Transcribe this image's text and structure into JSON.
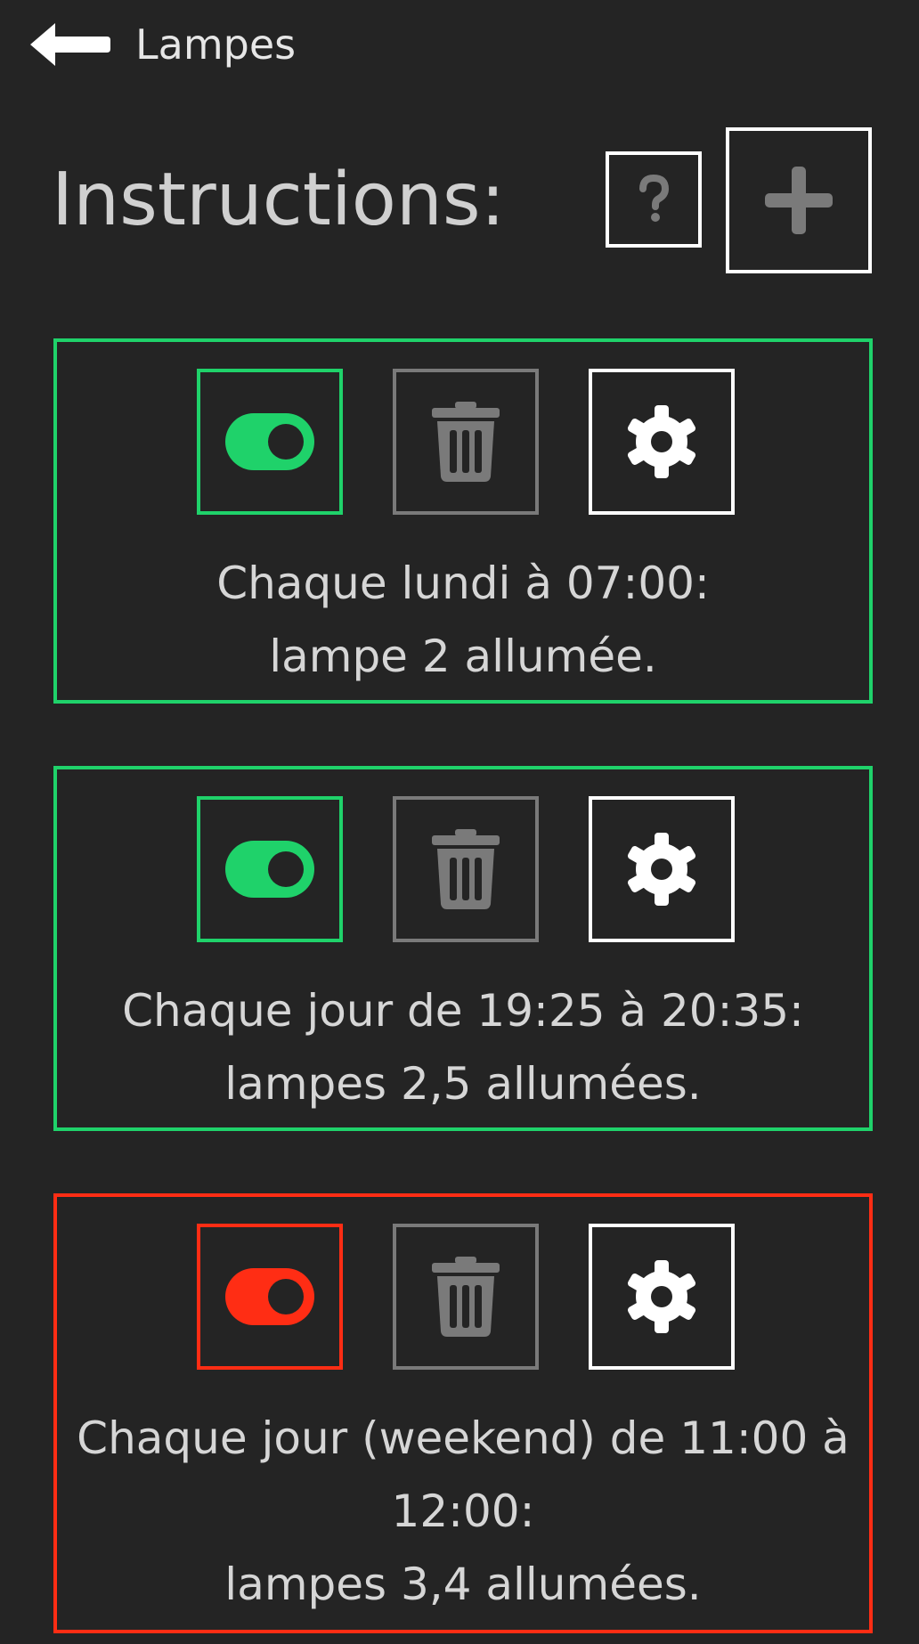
{
  "header": {
    "back_icon": "arrow-left-icon",
    "title": "Lampes"
  },
  "instructions": {
    "heading": "Instructions:",
    "help_icon": "question-icon",
    "add_icon": "plus-icon"
  },
  "colors": {
    "background": "#242424",
    "enabled": "#1fd26a",
    "disabled": "#ff2d14",
    "icon_gray": "#7a7a7a",
    "white": "#ffffff",
    "text": "#d6d6d6"
  },
  "cards": [
    {
      "enabled": true,
      "line1": "Chaque lundi à 07:00:",
      "line2": "lampe 2 allumée."
    },
    {
      "enabled": true,
      "line1": "Chaque jour de 19:25 à 20:35:",
      "line2": "lampes 2,5 allumées."
    },
    {
      "enabled": false,
      "line1a": "Chaque jour (weekend) de 11:00 à",
      "line1b": "12:00:",
      "line2": "lampes 3,4 allumées."
    }
  ]
}
